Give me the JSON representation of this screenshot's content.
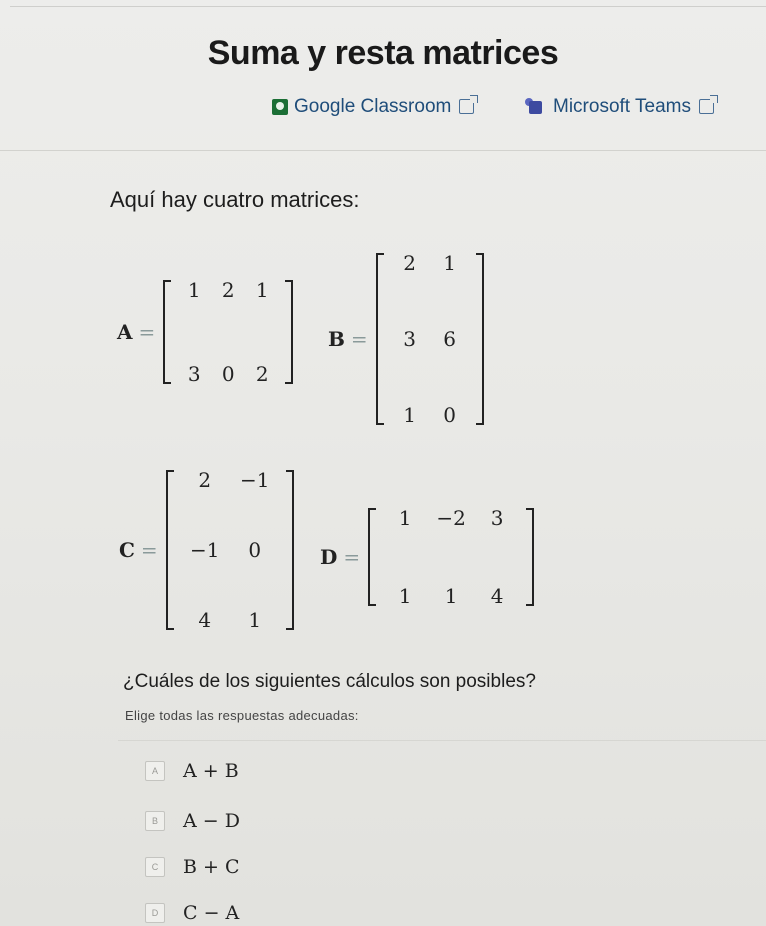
{
  "title": "Suma y resta matrices",
  "share": {
    "google_classroom": "Google Classroom",
    "microsoft_teams": "Microsoft Teams"
  },
  "intro": "Aquí hay cuatro matrices:",
  "matrices": {
    "A": {
      "name": "A",
      "eq": "=",
      "rows": [
        [
          "1",
          "2",
          "1"
        ],
        [
          "3",
          "0",
          "2"
        ]
      ]
    },
    "B": {
      "name": "B",
      "eq": "=",
      "rows": [
        [
          "2",
          "1"
        ],
        [
          "3",
          "6"
        ],
        [
          "1",
          "0"
        ]
      ]
    },
    "C": {
      "name": "C",
      "eq": "=",
      "rows": [
        [
          "2",
          "−1"
        ],
        [
          "−1",
          "0"
        ],
        [
          "4",
          "1"
        ]
      ]
    },
    "D": {
      "name": "D",
      "eq": "=",
      "rows": [
        [
          "1",
          "−2",
          "3"
        ],
        [
          "1",
          "1",
          "4"
        ]
      ]
    }
  },
  "question": "¿Cuáles de los siguientes cálculos son posibles?",
  "hint": "Elige todas las respuestas adecuadas:",
  "options": [
    {
      "letter": "A",
      "expr": "A + B"
    },
    {
      "letter": "B",
      "expr": "A − D"
    },
    {
      "letter": "C",
      "expr": "B + C"
    },
    {
      "letter": "D",
      "expr": "C − A"
    }
  ]
}
